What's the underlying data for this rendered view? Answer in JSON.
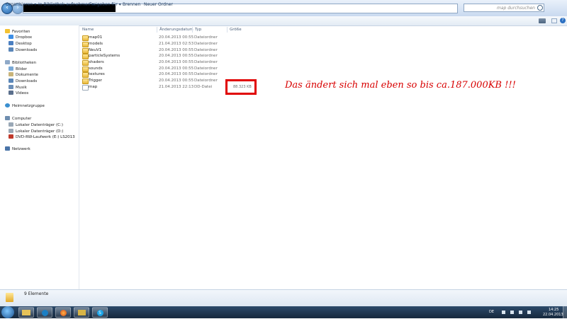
{
  "address": {
    "search_placeholder": "map durchsuchen"
  },
  "toolbar": {
    "organize": "Organisieren ▾",
    "library": "In Bibliothek aufnehmen ▾",
    "share": "Freigeben für ▾",
    "burn": "Brennen",
    "new_folder": "Neuer Ordner"
  },
  "nav": {
    "favorites": {
      "label": "Favoriten",
      "items": [
        "Dropbox",
        "Desktop",
        "Downloads"
      ]
    },
    "libraries": {
      "label": "Bibliotheken",
      "items": [
        "Bilder",
        "Dokumente",
        "Downloads",
        "Musik",
        "Videos"
      ]
    },
    "homegroup": "Heimnetzgruppe",
    "computer": {
      "label": "Computer",
      "items": [
        "Lokaler Datenträger (C:)",
        "Lokaler Datenträger (D:)",
        "DVD-RW-Laufwerk (E:) LS2013"
      ]
    },
    "network": "Netzwerk"
  },
  "columns": {
    "name": "Name",
    "date": "Änderungsdatum",
    "type": "Typ",
    "size": "Größe"
  },
  "files": [
    {
      "name": "map01",
      "date": "20.04.2013 00:55",
      "type": "Dateiordner"
    },
    {
      "name": "models",
      "date": "21.04.2013 02:53",
      "type": "Dateiordner"
    },
    {
      "name": "NeuV1",
      "date": "20.04.2013 00:55",
      "type": "Dateiordner"
    },
    {
      "name": "particleSystems",
      "date": "20.04.2013 00:55",
      "type": "Dateiordner"
    },
    {
      "name": "shaders",
      "date": "20.04.2013 00:55",
      "type": "Dateiordner"
    },
    {
      "name": "sounds",
      "date": "20.04.2013 00:55",
      "type": "Dateiordner"
    },
    {
      "name": "textures",
      "date": "20.04.2013 00:55",
      "type": "Dateiordner"
    },
    {
      "name": "Trigger",
      "date": "20.04.2013 00:55",
      "type": "Dateiordner"
    },
    {
      "name": "map",
      "date": "21.04.2013 22:13",
      "type": "DD-Datei",
      "size": "88.323 KB"
    }
  ],
  "annotation": "Das ändert sich mal eben so bis ca.187.000KB !!!",
  "status": {
    "count": "9 Elemente"
  },
  "taskbar": {
    "language": "DE",
    "time": "14:25",
    "date": "22.04.2013"
  }
}
